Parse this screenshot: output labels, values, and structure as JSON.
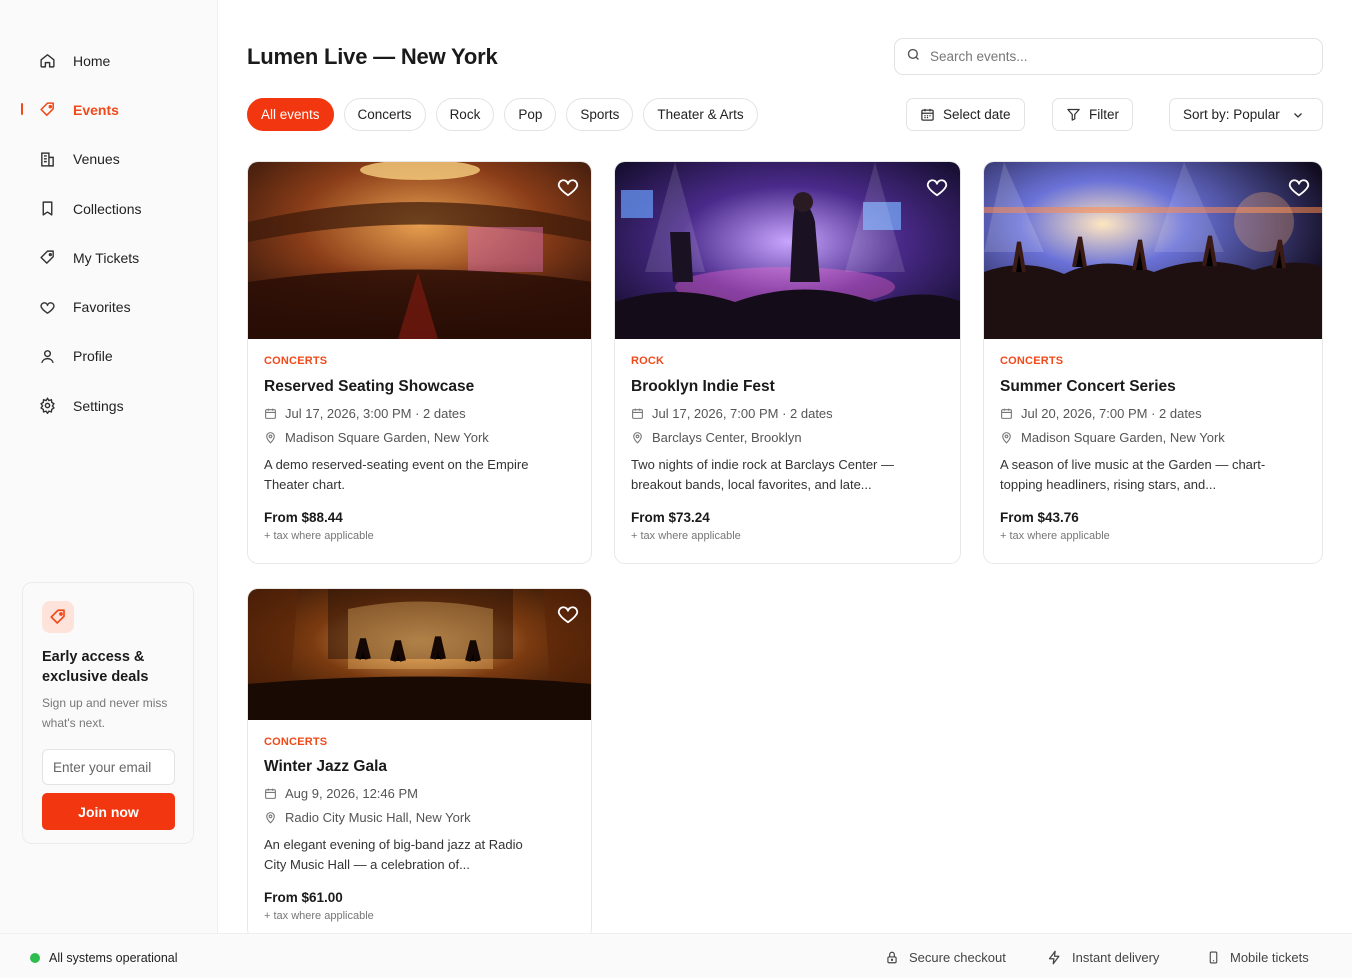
{
  "app": {
    "title": "Lumen Live — New York"
  },
  "colors": {
    "accent": "#f2360f",
    "status_ok": "#2dbd4e"
  },
  "sidebar": {
    "items": [
      {
        "label": "Home",
        "icon": "home-icon"
      },
      {
        "label": "Events",
        "icon": "tag-icon",
        "active": true
      },
      {
        "label": "Venues",
        "icon": "building-icon"
      },
      {
        "label": "Collections",
        "icon": "bookmark-icon"
      },
      {
        "label": "My Tickets",
        "icon": "ticket-icon"
      },
      {
        "label": "Favorites",
        "icon": "heart-icon"
      },
      {
        "label": "Profile",
        "icon": "user-icon"
      },
      {
        "label": "Settings",
        "icon": "gear-icon"
      }
    ],
    "promo": {
      "title": "Early access & exclusive deals",
      "text": "Sign up and never miss what's next.",
      "email_placeholder": "Enter your email",
      "button": "Join now"
    }
  },
  "search": {
    "placeholder": "Search events..."
  },
  "filters": {
    "chips": [
      "All events",
      "Concerts",
      "Rock",
      "Pop",
      "Sports",
      "Theater & Arts"
    ],
    "active_chip": "All events",
    "select_date": "Select date",
    "filter": "Filter",
    "sort": "Sort by: Popular"
  },
  "events": [
    {
      "category": "CONCERTS",
      "name": "Reserved Seating Showcase",
      "date": "Jul 17, 2026, 3:00 PM · 2 dates",
      "venue": "Madison Square Garden, New York",
      "description": "A demo reserved-seating event on the Empire Theater chart.",
      "price": "From $88.44",
      "tax": "+ tax where applicable"
    },
    {
      "category": "ROCK",
      "name": "Brooklyn Indie Fest",
      "date": "Jul 17, 2026, 7:00 PM · 2 dates",
      "venue": "Barclays Center, Brooklyn",
      "description": "Two nights of indie rock at Barclays Center — breakout bands, local favorites, and late...",
      "price": "From $73.24",
      "tax": "+ tax where applicable"
    },
    {
      "category": "CONCERTS",
      "name": "Summer Concert Series",
      "date": "Jul 20, 2026, 7:00 PM · 2 dates",
      "venue": "Madison Square Garden, New York",
      "description": "A season of live music at the Garden — chart-topping headliners, rising stars, and...",
      "price": "From $43.76",
      "tax": "+ tax where applicable"
    },
    {
      "category": "CONCERTS",
      "name": "Winter Jazz Gala",
      "date": "Aug 9, 2026, 12:46 PM",
      "venue": "Radio City Music Hall, New York",
      "description": "An elegant evening of big-band jazz at Radio City Music Hall — a celebration of...",
      "price": "From $61.00",
      "tax": "+ tax where applicable"
    }
  ],
  "footer": {
    "status": "All systems operational",
    "secure": "Secure checkout",
    "instant": "Instant delivery",
    "mobile": "Mobile tickets"
  }
}
